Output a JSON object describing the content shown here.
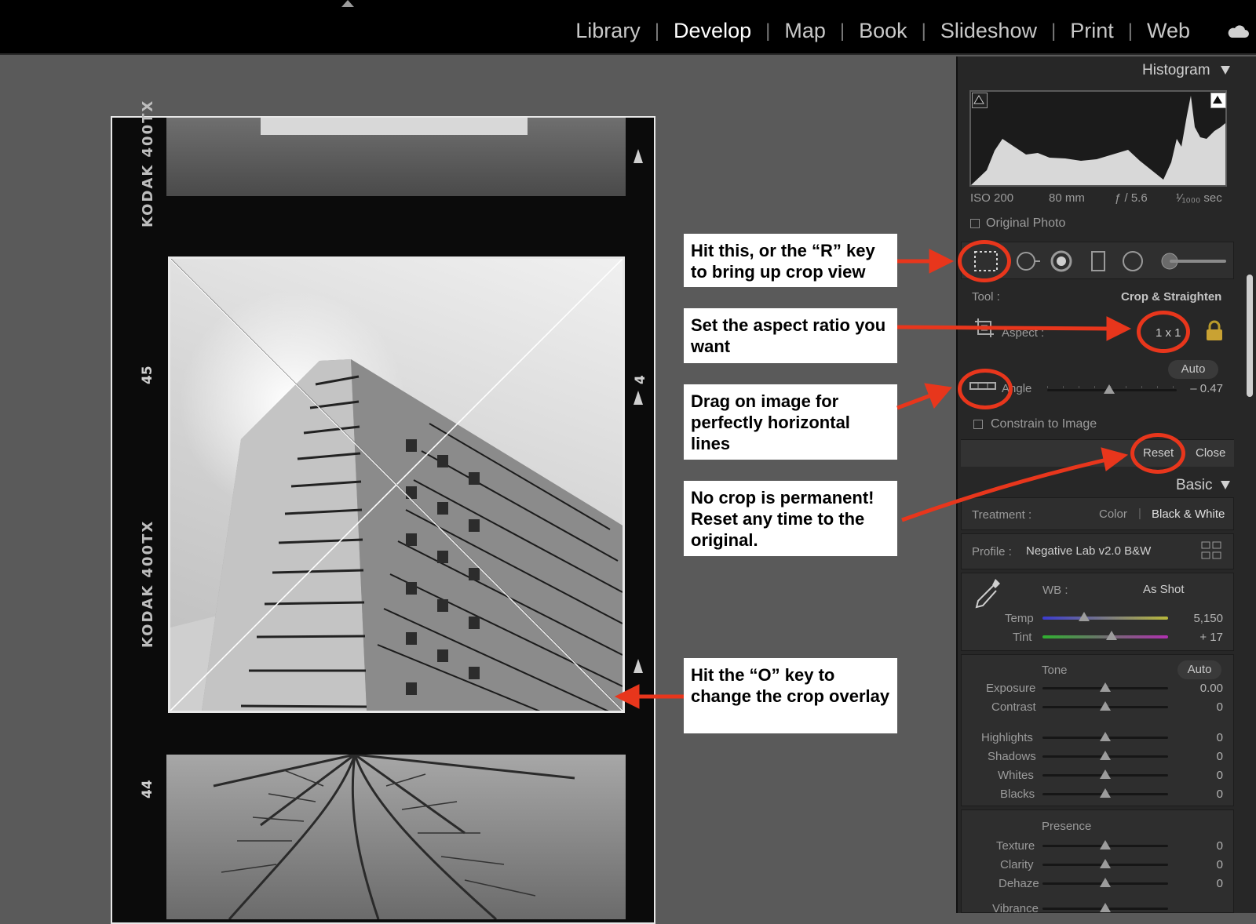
{
  "modules": [
    "Library",
    "Develop",
    "Map",
    "Book",
    "Slideshow",
    "Print",
    "Web"
  ],
  "active_module": "Develop",
  "film": {
    "brand_top": "KODAK 400TX",
    "brand_bottom": "KODAK 400TX",
    "frame_number_left": "45",
    "frame_number_left_bottom": "44",
    "frame_number_right": "4"
  },
  "callouts": {
    "crop_tool": "Hit this, or the “R” key to bring up crop view",
    "aspect": "Set the aspect ratio you want",
    "angle": "Drag on image for perfectly horizontal lines",
    "reset": "No crop is permanent! Reset any time to the original.",
    "overlay": "Hit the “O” key to change the crop overlay"
  },
  "histogram": {
    "title": "Histogram",
    "iso": "ISO 200",
    "focal": "80 mm",
    "aperture": "ƒ / 5.6",
    "shutter": "¹⁄₁₀₀₀ sec",
    "original_photo": "Original Photo"
  },
  "crop_panel": {
    "tool_label": "Tool :",
    "tool_name": "Crop & Straighten",
    "aspect_label": "Aspect :",
    "aspect_value": "1 x 1",
    "auto_label": "Auto",
    "angle_label": "Angle",
    "angle_value": "– 0.47",
    "angle_level": -0.47,
    "constrain_label": "Constrain to Image",
    "reset_label": "Reset",
    "close_label": "Close"
  },
  "basic": {
    "title": "Basic",
    "treatment_label": "Treatment :",
    "treatment_color": "Color",
    "treatment_bw": "Black & White",
    "profile_label": "Profile :",
    "profile_value": "Negative Lab v2.0 B&W",
    "wb_label": "WB :",
    "wb_value": "As Shot",
    "temp_label": "Temp",
    "temp_value": "5,150",
    "tint_label": "Tint",
    "tint_value": "+ 17",
    "tone_label": "Tone",
    "tone_auto": "Auto",
    "exposure_label": "Exposure",
    "exposure_value": "0.00",
    "contrast_label": "Contrast",
    "contrast_value": "0",
    "highlights_label": "Highlights",
    "highlights_value": "0",
    "shadows_label": "Shadows",
    "shadows_value": "0",
    "whites_label": "Whites",
    "whites_value": "0",
    "blacks_label": "Blacks",
    "blacks_value": "0",
    "presence_label": "Presence",
    "texture_label": "Texture",
    "texture_value": "0",
    "clarity_label": "Clarity",
    "clarity_value": "0",
    "dehaze_label": "Dehaze",
    "dehaze_value": "0",
    "vibrance_label": "Vibrance"
  },
  "colors": {
    "accent_red": "#e8361c",
    "panel_bg": "#272727"
  }
}
